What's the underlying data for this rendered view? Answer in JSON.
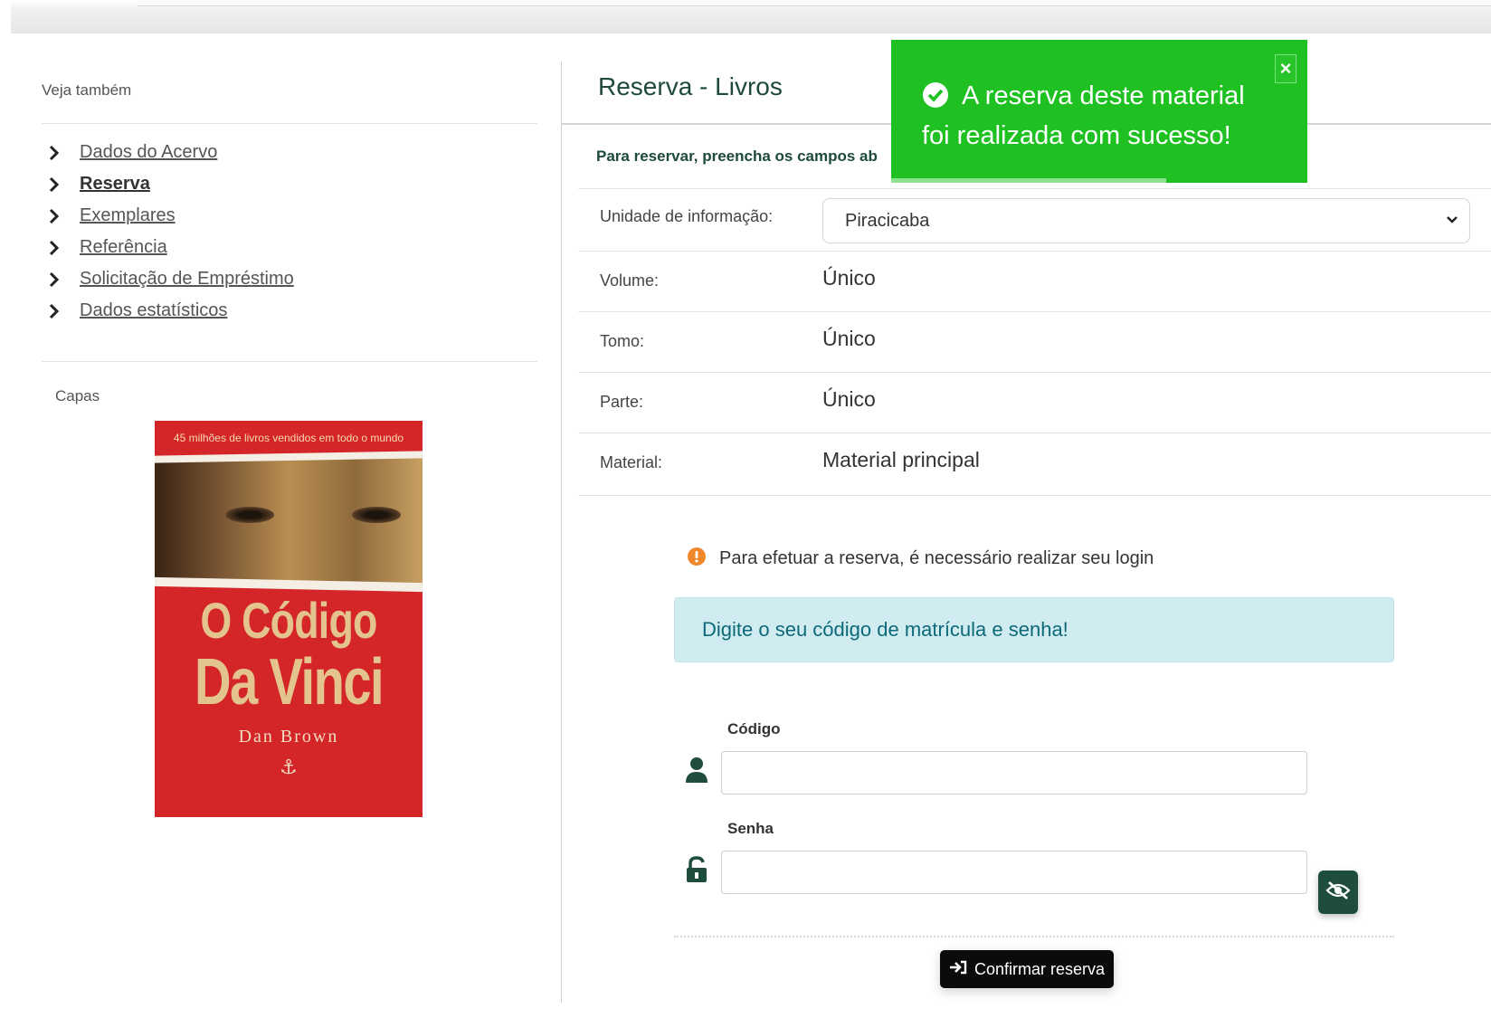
{
  "sidebar": {
    "see_also_title": "Veja também",
    "links": [
      {
        "label": "Dados do Acervo",
        "active": false
      },
      {
        "label": "Reserva",
        "active": true
      },
      {
        "label": "Exemplares",
        "active": false
      },
      {
        "label": "Referência",
        "active": false
      },
      {
        "label": "Solicitação de Empréstimo",
        "active": false
      },
      {
        "label": "Dados estatísticos",
        "active": false
      }
    ],
    "covers_title": "Capas",
    "cover": {
      "tagline": "45 milhões de livros vendidos em todo o mundo",
      "title_line1": "O Código",
      "title_line2": "Da Vinci",
      "author": "Dan Brown"
    }
  },
  "main": {
    "title": "Reserva - Livros",
    "instructions": "Para reservar, preencha os campos ab",
    "fields": {
      "unit_label": "Unidade de informação:",
      "unit_value": "Piracicaba",
      "volume_label": "Volume:",
      "volume_value": "Único",
      "tomo_label": "Tomo:",
      "tomo_value": "Único",
      "parte_label": "Parte:",
      "parte_value": "Único",
      "material_label": "Material:",
      "material_value": "Material principal"
    },
    "login": {
      "warning": "Para efetuar a reserva, é necessário realizar seu login",
      "info": "Digite o seu código de matrícula e senha!",
      "code_label": "Código",
      "code_value": "",
      "password_label": "Senha",
      "password_value": "",
      "confirm_label": "Confirmar reserva"
    }
  },
  "toast": {
    "message": "A reserva deste material foi realizada com sucesso!",
    "close_symbol": "×",
    "progress": 0.66
  },
  "colors": {
    "brand_green": "#1f4d3b",
    "toast_green": "#1ec121",
    "info_bg": "#d1ecf1",
    "warning_orange": "#f0882b"
  }
}
